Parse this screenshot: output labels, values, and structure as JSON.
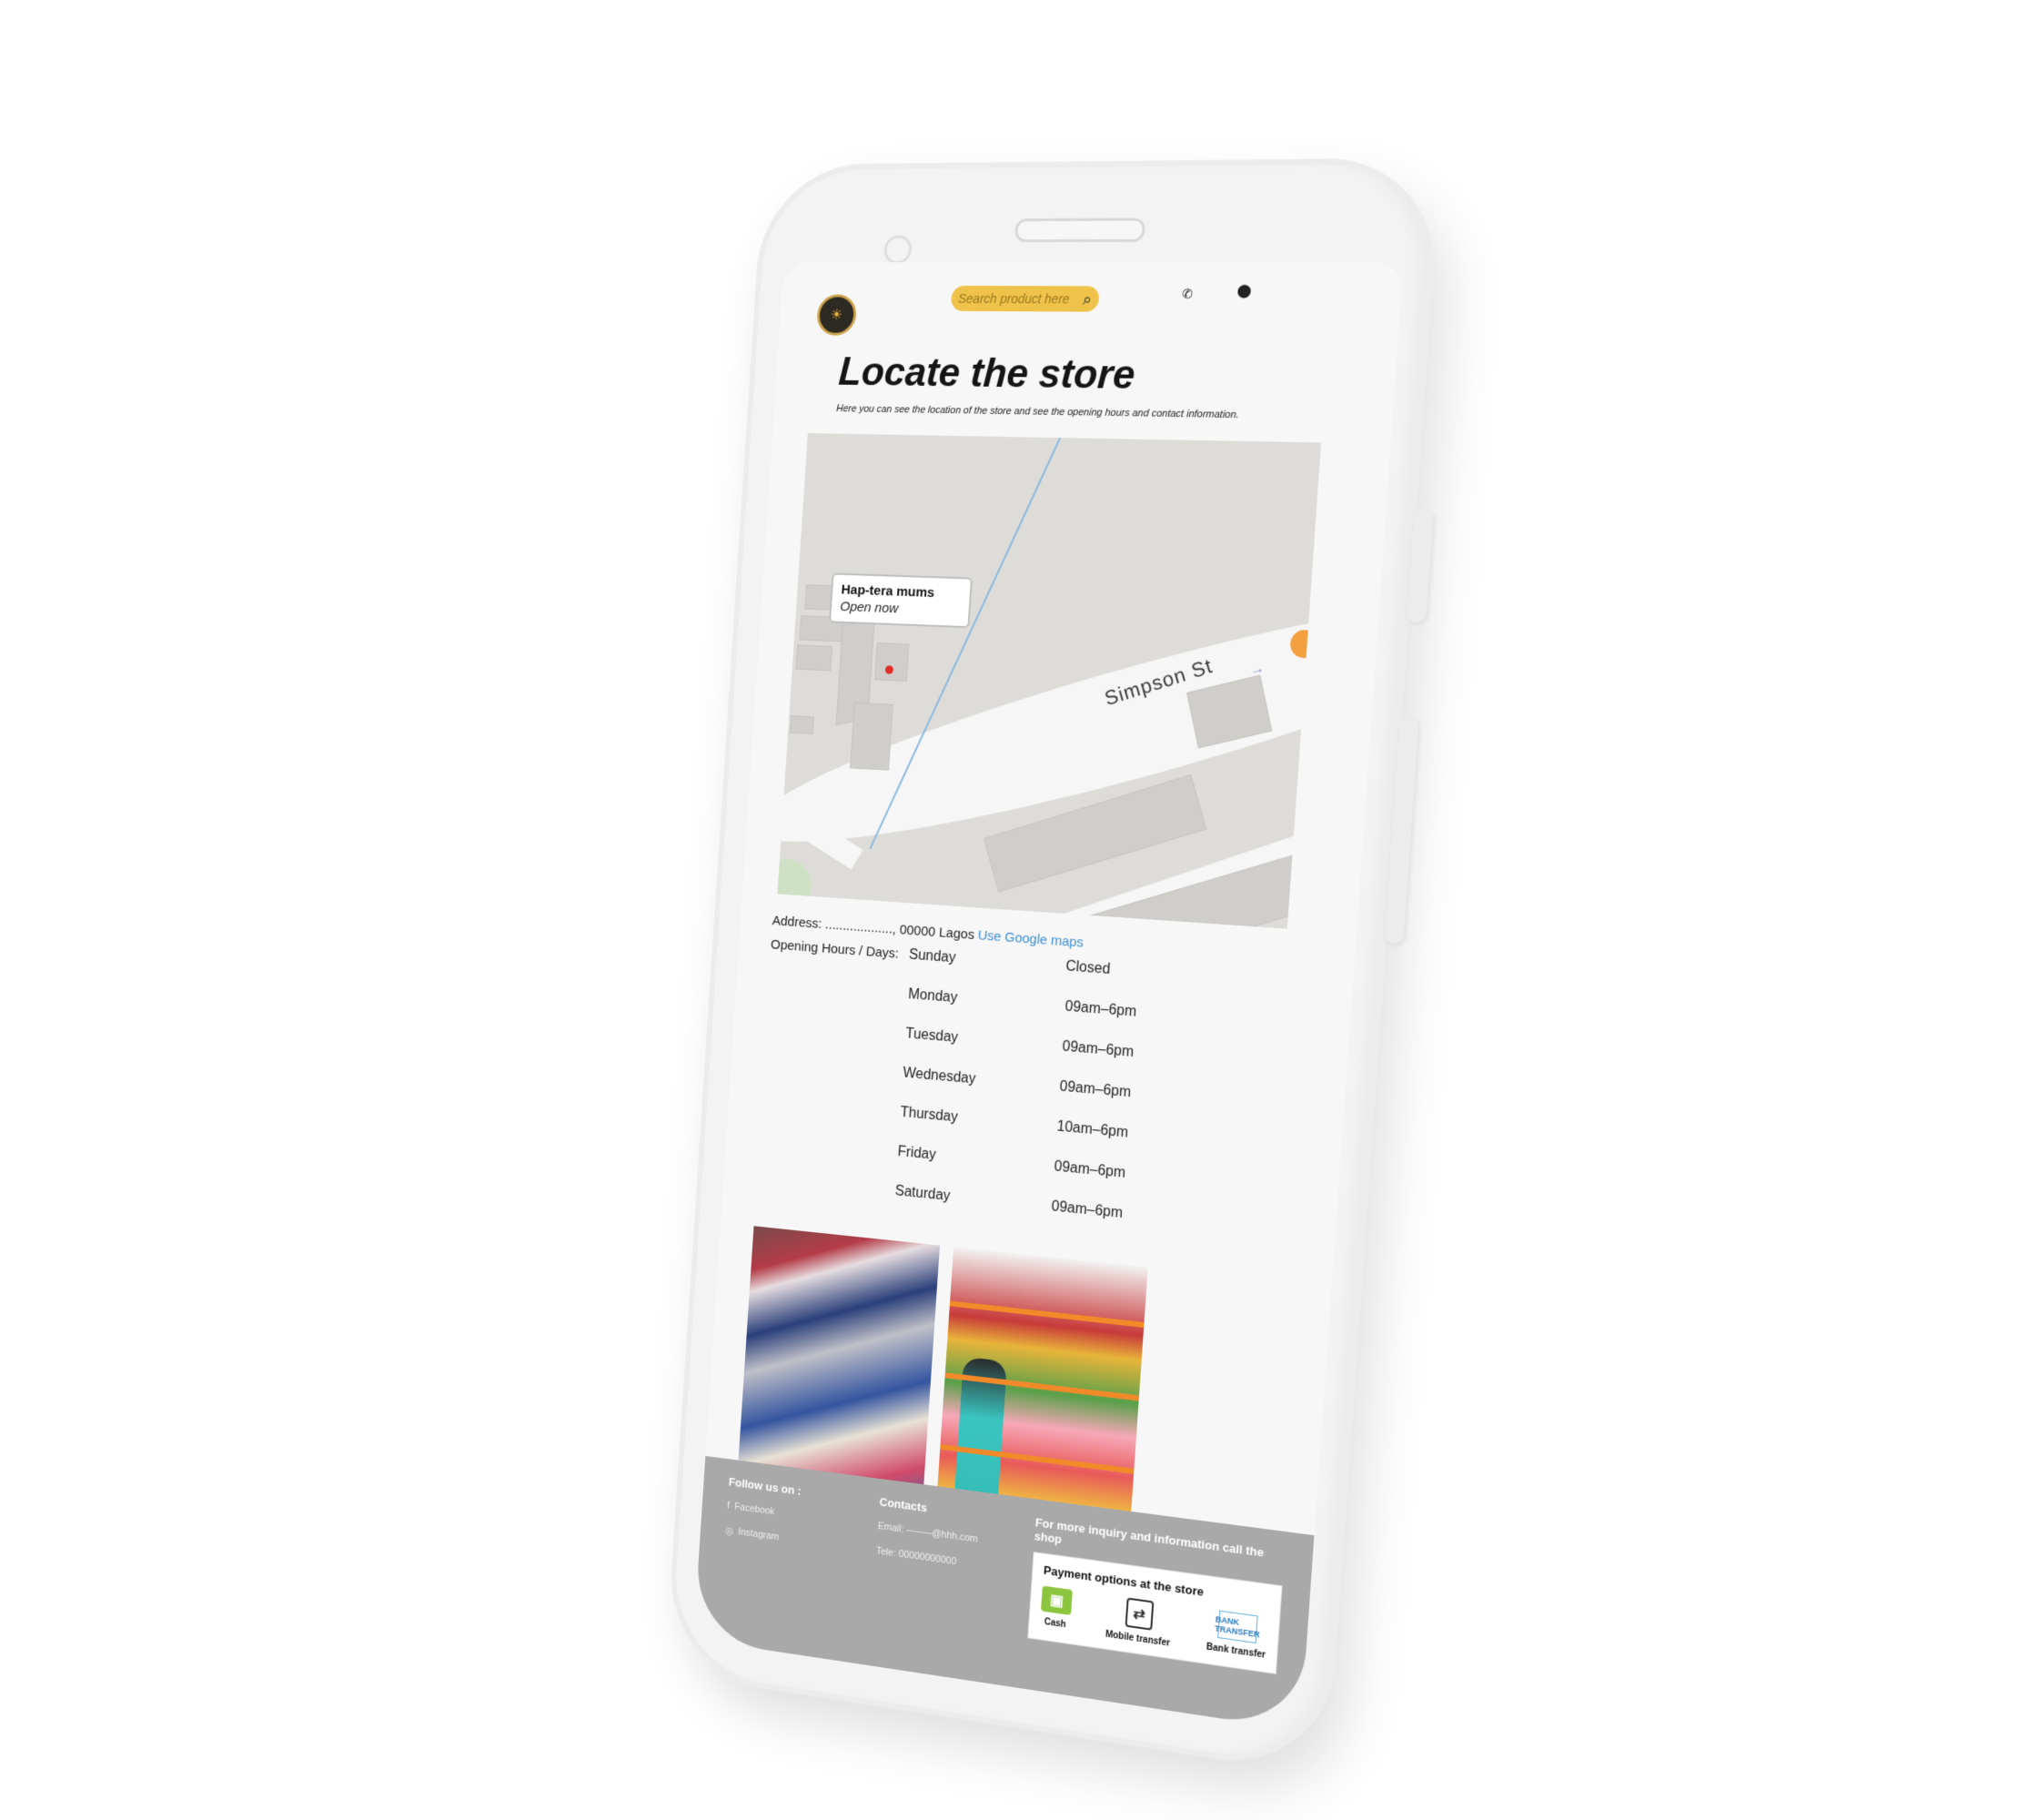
{
  "header": {
    "search_placeholder": "Search product here",
    "logo_icon": "store-logo",
    "phone_icon": "phone-icon",
    "location_icon": "pin-icon"
  },
  "page": {
    "title": "Locate the store",
    "subtitle": "Here you can see the location of the store and see the opening hours and contact information."
  },
  "map": {
    "store_name": "Hap-tera mums",
    "store_status": "Open now",
    "street_label": "Simpson St"
  },
  "info": {
    "address": "Address: ..................., 00000 Lagos",
    "google_maps_link": "Use Google maps",
    "hours_label": "Opening Hours / Days:",
    "hours": [
      {
        "day": "Sunday",
        "time": "Closed"
      },
      {
        "day": "Monday",
        "time": "09am–6pm"
      },
      {
        "day": "Tuesday",
        "time": "09am–6pm"
      },
      {
        "day": "Wednesday",
        "time": "09am–6pm"
      },
      {
        "day": "Thursday",
        "time": "10am–6pm"
      },
      {
        "day": "Friday",
        "time": "09am–6pm"
      },
      {
        "day": "Saturday",
        "time": "09am–6pm"
      }
    ]
  },
  "footer": {
    "follow_title": "Follow us on :",
    "facebook": "Facebook",
    "instagram": "Instagram",
    "contacts_title": "Contacts",
    "email": "Email: --------@hhh.com",
    "tele": "Tele: 00000000000",
    "inquiry": "For more inquiry and information call the shop",
    "payment_title": "Payment options at the store",
    "payment_options": [
      "Cash",
      "Mobile transfer",
      "Bank transfer"
    ],
    "bank_icon_text": "BANK TRANSFER"
  },
  "colors": {
    "accent": "#efc24a",
    "footer_bg": "#a9a9a9",
    "link": "#3d8fd3",
    "marker": "#e32b2b"
  }
}
